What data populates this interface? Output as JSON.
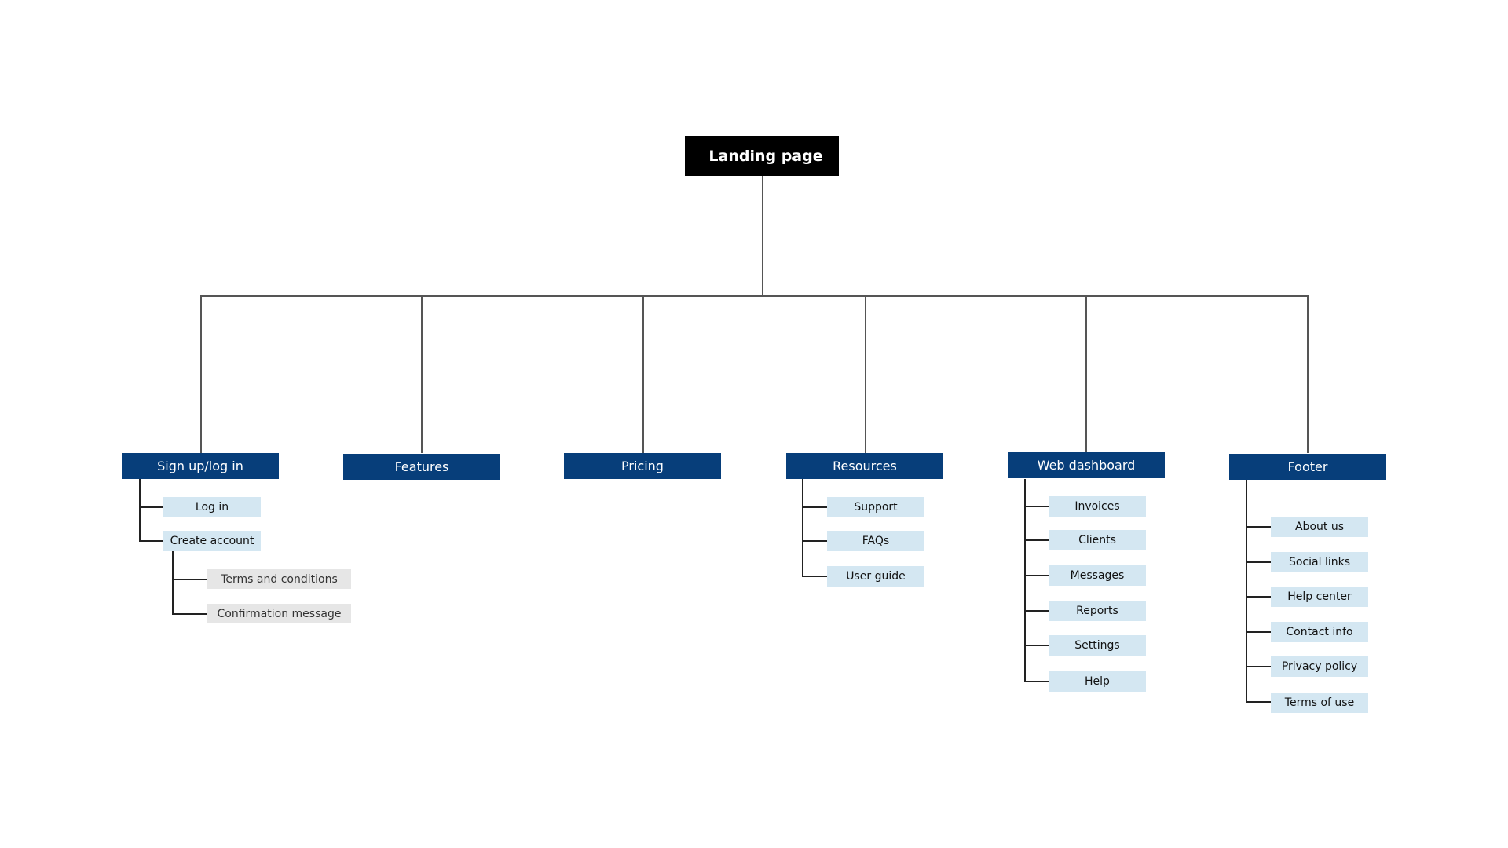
{
  "root": {
    "label": "Landing page"
  },
  "sections": [
    {
      "label": "Sign up/log in",
      "children": [
        {
          "label": "Log in"
        },
        {
          "label": "Create account",
          "children": [
            {
              "label": "Terms and conditions"
            },
            {
              "label": "Confirmation message"
            }
          ]
        }
      ]
    },
    {
      "label": "Features",
      "children": []
    },
    {
      "label": "Pricing",
      "children": []
    },
    {
      "label": "Resources",
      "children": [
        {
          "label": "Support"
        },
        {
          "label": "FAQs"
        },
        {
          "label": "User guide"
        }
      ]
    },
    {
      "label": "Web dashboard",
      "children": [
        {
          "label": "Invoices"
        },
        {
          "label": "Clients"
        },
        {
          "label": "Messages"
        },
        {
          "label": "Reports"
        },
        {
          "label": "Settings"
        },
        {
          "label": "Help"
        }
      ]
    },
    {
      "label": "Footer",
      "children": [
        {
          "label": "About us"
        },
        {
          "label": "Social links"
        },
        {
          "label": "Help center"
        },
        {
          "label": "Contact info"
        },
        {
          "label": "Privacy policy"
        },
        {
          "label": "Terms of use"
        }
      ]
    }
  ],
  "colors": {
    "root": "#000000",
    "section": "#073e7a",
    "subpage": "#d4e7f2",
    "subsubpage": "#e6e6e6"
  }
}
